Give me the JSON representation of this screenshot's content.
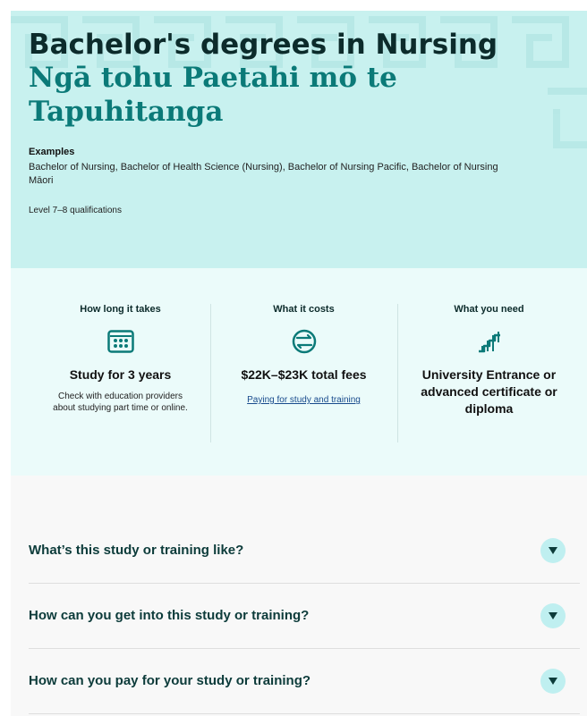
{
  "hero": {
    "title_en": "Bachelor's degrees in Nursing",
    "title_mi": "Ngā tohu Paetahi mō te Tapuhitanga",
    "examples_heading": "Examples",
    "examples_text": "Bachelor of Nursing, Bachelor of Health Science (Nursing), Bachelor of Nursing Pacific, Bachelor of Nursing Māori",
    "level": "Level 7–8 qualifications"
  },
  "stats": [
    {
      "heading": "How long it takes",
      "icon": "calendar-abacus-icon",
      "value": "Study for 3 years",
      "description": "Check with education providers about studying part time or online."
    },
    {
      "heading": "What it costs",
      "icon": "currency-exchange-icon",
      "value": "$22K–$23K total fees",
      "link": "Paying for study and training"
    },
    {
      "heading": "What you need",
      "icon": "stairs-icon",
      "value": "University Entrance or advanced certificate or diploma"
    }
  ],
  "accordion": [
    {
      "question": "What’s this study or training like?"
    },
    {
      "question": "How can you get into this study or training?"
    },
    {
      "question": "How can you pay for your study or training?"
    }
  ],
  "colors": {
    "hero_bg": "#c8f1ef",
    "stats_bg": "#ebfbfa",
    "teal": "#0b7a78",
    "dark_teal": "#0c3b3a",
    "chevron_bg": "#bfeff0"
  }
}
